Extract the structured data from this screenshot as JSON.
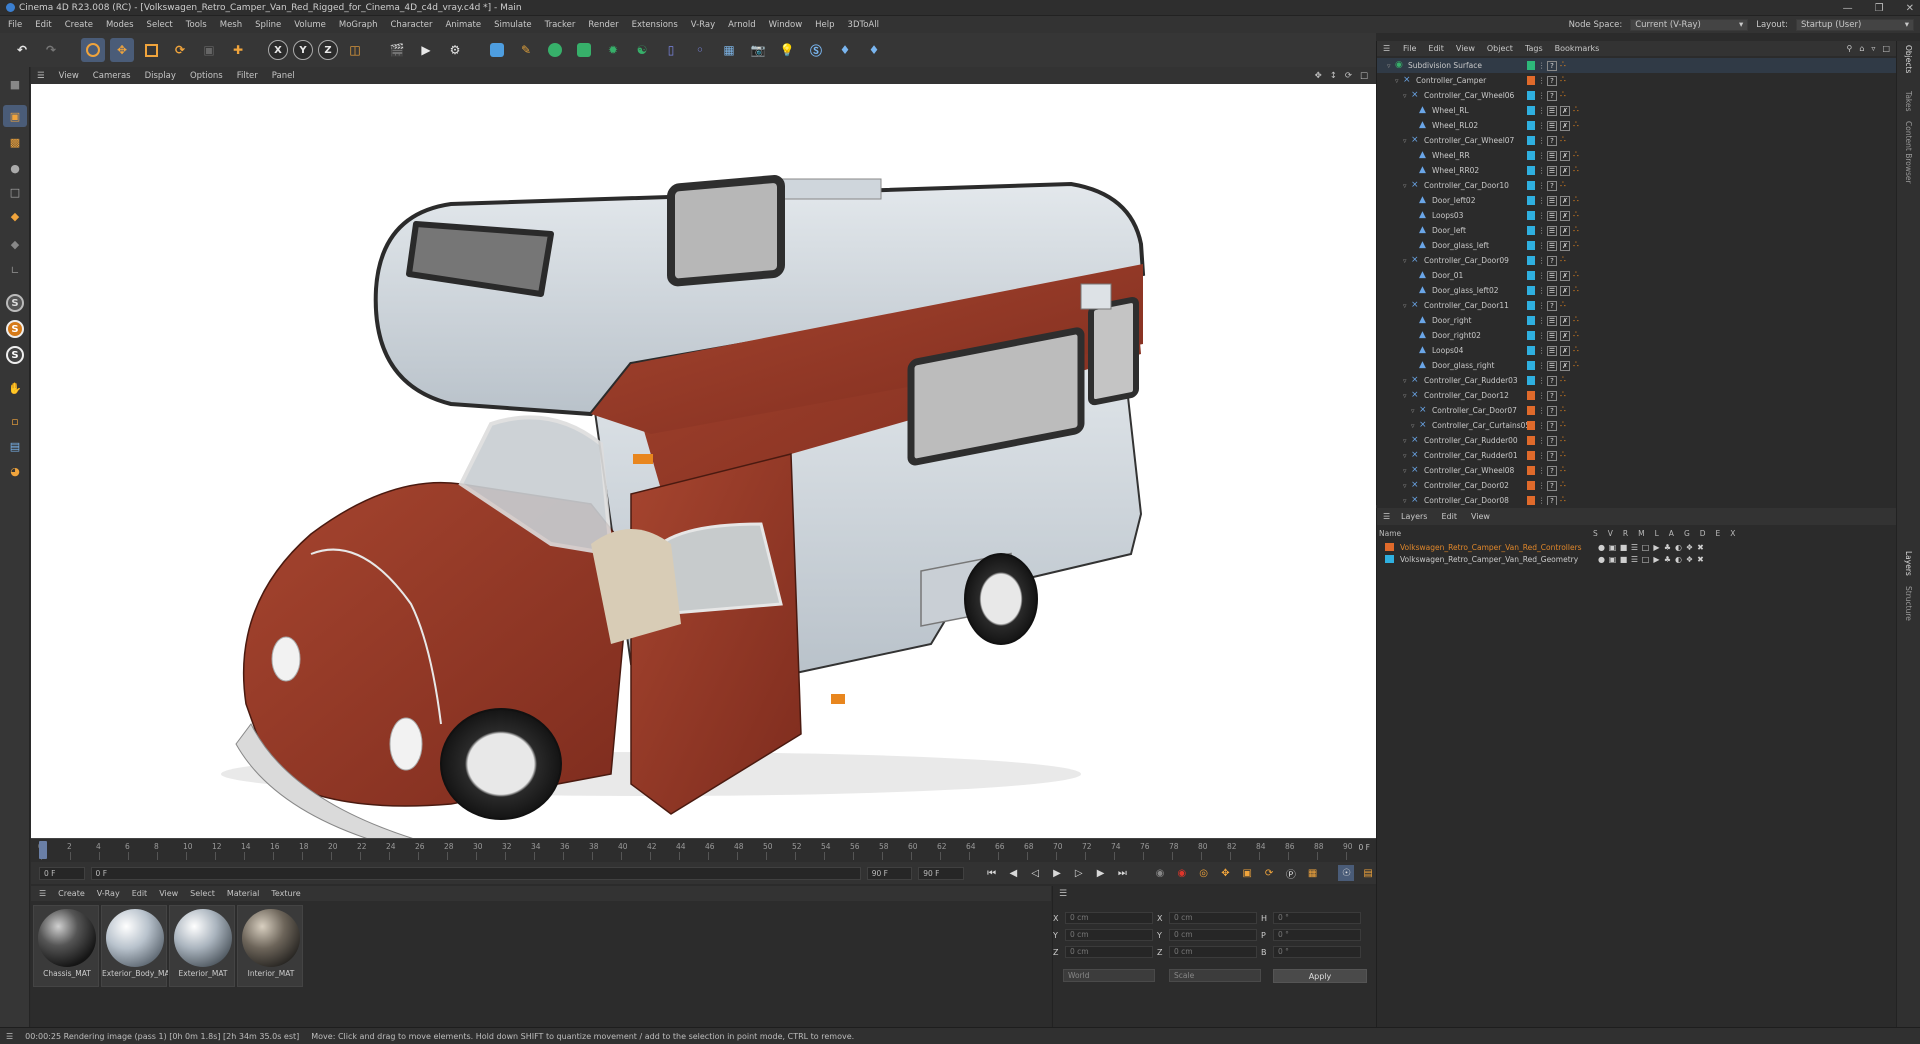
{
  "window": {
    "title": "Cinema 4D R23.008 (RC) - [Volkswagen_Retro_Camper_Van_Red_Rigged_for_Cinema_4D_c4d_vray.c4d *] - Main"
  },
  "menubar": {
    "items": [
      "File",
      "Edit",
      "Create",
      "Modes",
      "Select",
      "Tools",
      "Mesh",
      "Spline",
      "Volume",
      "MoGraph",
      "Character",
      "Animate",
      "Simulate",
      "Tracker",
      "Render",
      "Extensions",
      "V-Ray",
      "Arnold",
      "Window",
      "Help",
      "3DToAll"
    ],
    "node_space_label": "Node Space:",
    "node_space_value": "Current (V-Ray)",
    "layout_label": "Layout:",
    "layout_value": "Startup (User)"
  },
  "toolbar": {
    "axis_x": "X",
    "axis_y": "Y",
    "axis_z": "Z"
  },
  "viewport": {
    "menu": [
      "View",
      "Cameras",
      "Display",
      "Options",
      "Filter",
      "Panel"
    ]
  },
  "timeline": {
    "ticks": [
      "0",
      "2",
      "4",
      "6",
      "8",
      "10",
      "12",
      "14",
      "16",
      "18",
      "20",
      "22",
      "24",
      "26",
      "28",
      "30",
      "32",
      "34",
      "36",
      "38",
      "40",
      "42",
      "44",
      "46",
      "48",
      "50",
      "52",
      "54",
      "56",
      "58",
      "60",
      "62",
      "64",
      "66",
      "68",
      "70",
      "72",
      "74",
      "76",
      "78",
      "80",
      "82",
      "84",
      "86",
      "88",
      "90"
    ],
    "end_label": "0 F",
    "start_field": "0 F",
    "current_field": "0 F",
    "end_field_a": "90 F",
    "end_field_b": "90 F"
  },
  "materials": {
    "menu": [
      "Create",
      "V-Ray",
      "Edit",
      "View",
      "Select",
      "Material",
      "Texture"
    ],
    "items": [
      {
        "name": "Chassis_MAT"
      },
      {
        "name": "Exterior_Body_MAT"
      },
      {
        "name": "Exterior_MAT"
      },
      {
        "name": "Interior_MAT"
      }
    ]
  },
  "coordinates": {
    "rows": [
      {
        "a": "X",
        "av": "0 cm",
        "b": "X",
        "bv": "0 cm",
        "c": "H",
        "cv": "0 °"
      },
      {
        "a": "Y",
        "av": "0 cm",
        "b": "Y",
        "bv": "0 cm",
        "c": "P",
        "cv": "0 °"
      },
      {
        "a": "Z",
        "av": "0 cm",
        "b": "Z",
        "bv": "0 cm",
        "c": "B",
        "cv": "0 °"
      }
    ],
    "mode_select": "World",
    "scale_select": "Scale",
    "apply_label": "Apply"
  },
  "objects": {
    "menu": [
      "File",
      "Edit",
      "View",
      "Object",
      "Tags",
      "Bookmarks"
    ],
    "rows": [
      {
        "name": "Subdivision Surface",
        "indent": 0,
        "color": "#2db87a",
        "icon": "subdiv"
      },
      {
        "name": "Controller_Camper",
        "indent": 1,
        "color": "#e06a2b",
        "icon": "null"
      },
      {
        "name": "Controller_Car_Wheel06",
        "indent": 2,
        "color": "#2fb0e0",
        "icon": "null"
      },
      {
        "name": "Wheel_RL",
        "indent": 3,
        "color": "#2fb0e0",
        "icon": "obj"
      },
      {
        "name": "Wheel_RL02",
        "indent": 3,
        "color": "#2fb0e0",
        "icon": "obj"
      },
      {
        "name": "Controller_Car_Wheel07",
        "indent": 2,
        "color": "#2fb0e0",
        "icon": "null"
      },
      {
        "name": "Wheel_RR",
        "indent": 3,
        "color": "#2fb0e0",
        "icon": "obj"
      },
      {
        "name": "Wheel_RR02",
        "indent": 3,
        "color": "#2fb0e0",
        "icon": "obj"
      },
      {
        "name": "Controller_Car_Door10",
        "indent": 2,
        "color": "#2fb0e0",
        "icon": "null"
      },
      {
        "name": "Door_left02",
        "indent": 3,
        "color": "#2fb0e0",
        "icon": "obj"
      },
      {
        "name": "Loops03",
        "indent": 3,
        "color": "#2fb0e0",
        "icon": "obj"
      },
      {
        "name": "Door_left",
        "indent": 3,
        "color": "#2fb0e0",
        "icon": "obj"
      },
      {
        "name": "Door_glass_left",
        "indent": 3,
        "color": "#2fb0e0",
        "icon": "obj"
      },
      {
        "name": "Controller_Car_Door09",
        "indent": 2,
        "color": "#2fb0e0",
        "icon": "null"
      },
      {
        "name": "Door_01",
        "indent": 3,
        "color": "#2fb0e0",
        "icon": "obj"
      },
      {
        "name": "Door_glass_left02",
        "indent": 3,
        "color": "#2fb0e0",
        "icon": "obj"
      },
      {
        "name": "Controller_Car_Door11",
        "indent": 2,
        "color": "#2fb0e0",
        "icon": "null"
      },
      {
        "name": "Door_right",
        "indent": 3,
        "color": "#2fb0e0",
        "icon": "obj"
      },
      {
        "name": "Door_right02",
        "indent": 3,
        "color": "#2fb0e0",
        "icon": "obj"
      },
      {
        "name": "Loops04",
        "indent": 3,
        "color": "#2fb0e0",
        "icon": "obj"
      },
      {
        "name": "Door_glass_right",
        "indent": 3,
        "color": "#2fb0e0",
        "icon": "obj"
      },
      {
        "name": "Controller_Car_Rudder03",
        "indent": 2,
        "color": "#2fb0e0",
        "icon": "null"
      },
      {
        "name": "Controller_Car_Door12",
        "indent": 2,
        "color": "#e06a2b",
        "icon": "null"
      },
      {
        "name": "Controller_Car_Door07",
        "indent": 3,
        "color": "#e06a2b",
        "icon": "null"
      },
      {
        "name": "Controller_Car_Curtains05",
        "indent": 3,
        "color": "#e06a2b",
        "icon": "null"
      },
      {
        "name": "Controller_Car_Rudder00",
        "indent": 2,
        "color": "#e06a2b",
        "icon": "null"
      },
      {
        "name": "Controller_Car_Rudder01",
        "indent": 2,
        "color": "#e06a2b",
        "icon": "null"
      },
      {
        "name": "Controller_Car_Wheel08",
        "indent": 2,
        "color": "#e06a2b",
        "icon": "null"
      },
      {
        "name": "Controller_Car_Door02",
        "indent": 2,
        "color": "#e06a2b",
        "icon": "null"
      },
      {
        "name": "Controller_Car_Door08",
        "indent": 2,
        "color": "#e06a2b",
        "icon": "null"
      }
    ]
  },
  "layers": {
    "menu": [
      "Layers",
      "Edit",
      "View"
    ],
    "header_name": "Name",
    "header_cols": [
      "S",
      "V",
      "R",
      "M",
      "L",
      "A",
      "G",
      "D",
      "E",
      "X"
    ],
    "rows": [
      {
        "name": "Volkswagen_Retro_Camper_Van_Red_Controllers",
        "color": "#e06a2b",
        "text_color": "#e0872b"
      },
      {
        "name": "Volkswagen_Retro_Camper_Van_Red_Geometry",
        "color": "#2fb0e0",
        "text_color": "#c9c9c9"
      }
    ]
  },
  "right_tabs": [
    "Objects",
    "Takes",
    "Content Browser",
    "Layers",
    "Structure"
  ],
  "statusbar": {
    "render": "00:00:25 Rendering image (pass 1) [0h  0m  1.8s] [2h 34m 35.0s est]",
    "hint": "Move: Click and drag to move elements. Hold down SHIFT to quantize movement / add to the selection in point mode, CTRL to remove."
  },
  "colors": {
    "accent_orange": "#f08a1c",
    "accent_blue": "#2fb0e0",
    "van_red": "#9c3a28",
    "van_white": "#d6dde4"
  }
}
